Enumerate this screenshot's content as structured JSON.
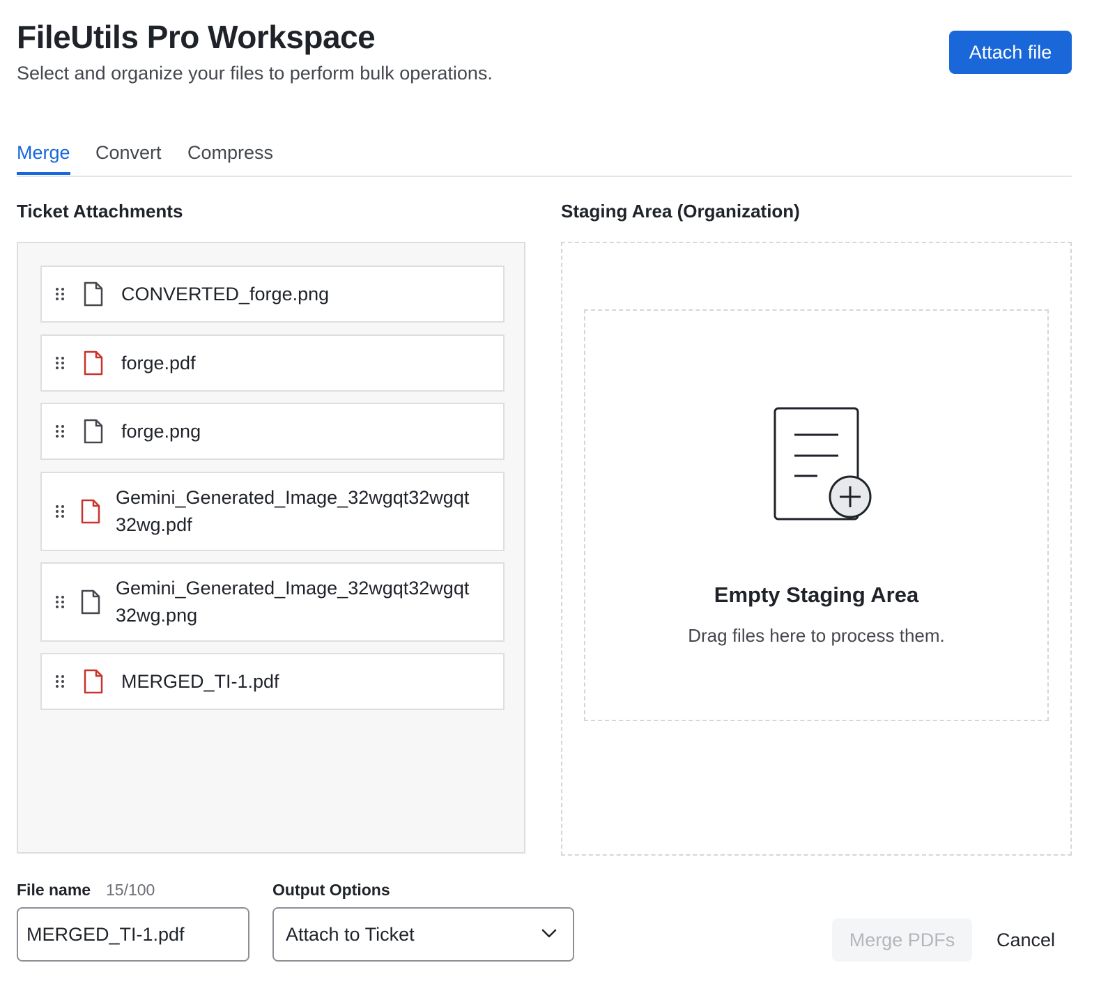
{
  "header": {
    "title": "FileUtils Pro Workspace",
    "subtitle": "Select and organize your files to perform bulk operations.",
    "attach_label": "Attach file"
  },
  "tabs": [
    {
      "label": "Merge",
      "active": true
    },
    {
      "label": "Convert",
      "active": false
    },
    {
      "label": "Compress",
      "active": false
    }
  ],
  "attachments": {
    "title": "Ticket Attachments",
    "files": [
      {
        "name_lines": [
          "CONVERTED_forge.png"
        ],
        "type": "image",
        "icon": "document-icon"
      },
      {
        "name_lines": [
          "forge.pdf"
        ],
        "type": "pdf",
        "icon": "pdf-document-icon"
      },
      {
        "name_lines": [
          "forge.png"
        ],
        "type": "image",
        "icon": "document-icon"
      },
      {
        "name_lines": [
          "Gemini_Generated_Image_32wgqt32wgqt",
          "32wg.pdf"
        ],
        "type": "pdf",
        "icon": "pdf-document-icon"
      },
      {
        "name_lines": [
          "Gemini_Generated_Image_32wgqt32wgqt",
          "32wg.png"
        ],
        "type": "image",
        "icon": "document-icon"
      },
      {
        "name_lines": [
          "MERGED_TI-1.pdf"
        ],
        "type": "pdf",
        "icon": "pdf-document-icon"
      }
    ]
  },
  "staging": {
    "title": "Staging Area (Organization)",
    "empty_title": "Empty Staging Area",
    "empty_desc": "Drag files here to process them.",
    "icon": "add-document-icon"
  },
  "footer": {
    "file_name_label": "File name",
    "char_count": "15/100",
    "file_name_value": "MERGED_TI-1.pdf",
    "output_label": "Output Options",
    "output_value": "Attach to Ticket",
    "merge_label": "Merge PDFs",
    "cancel_label": "Cancel"
  },
  "colors": {
    "accent": "#1967d9",
    "pdf_icon": "#c8342b",
    "generic_icon": "#44474d"
  }
}
